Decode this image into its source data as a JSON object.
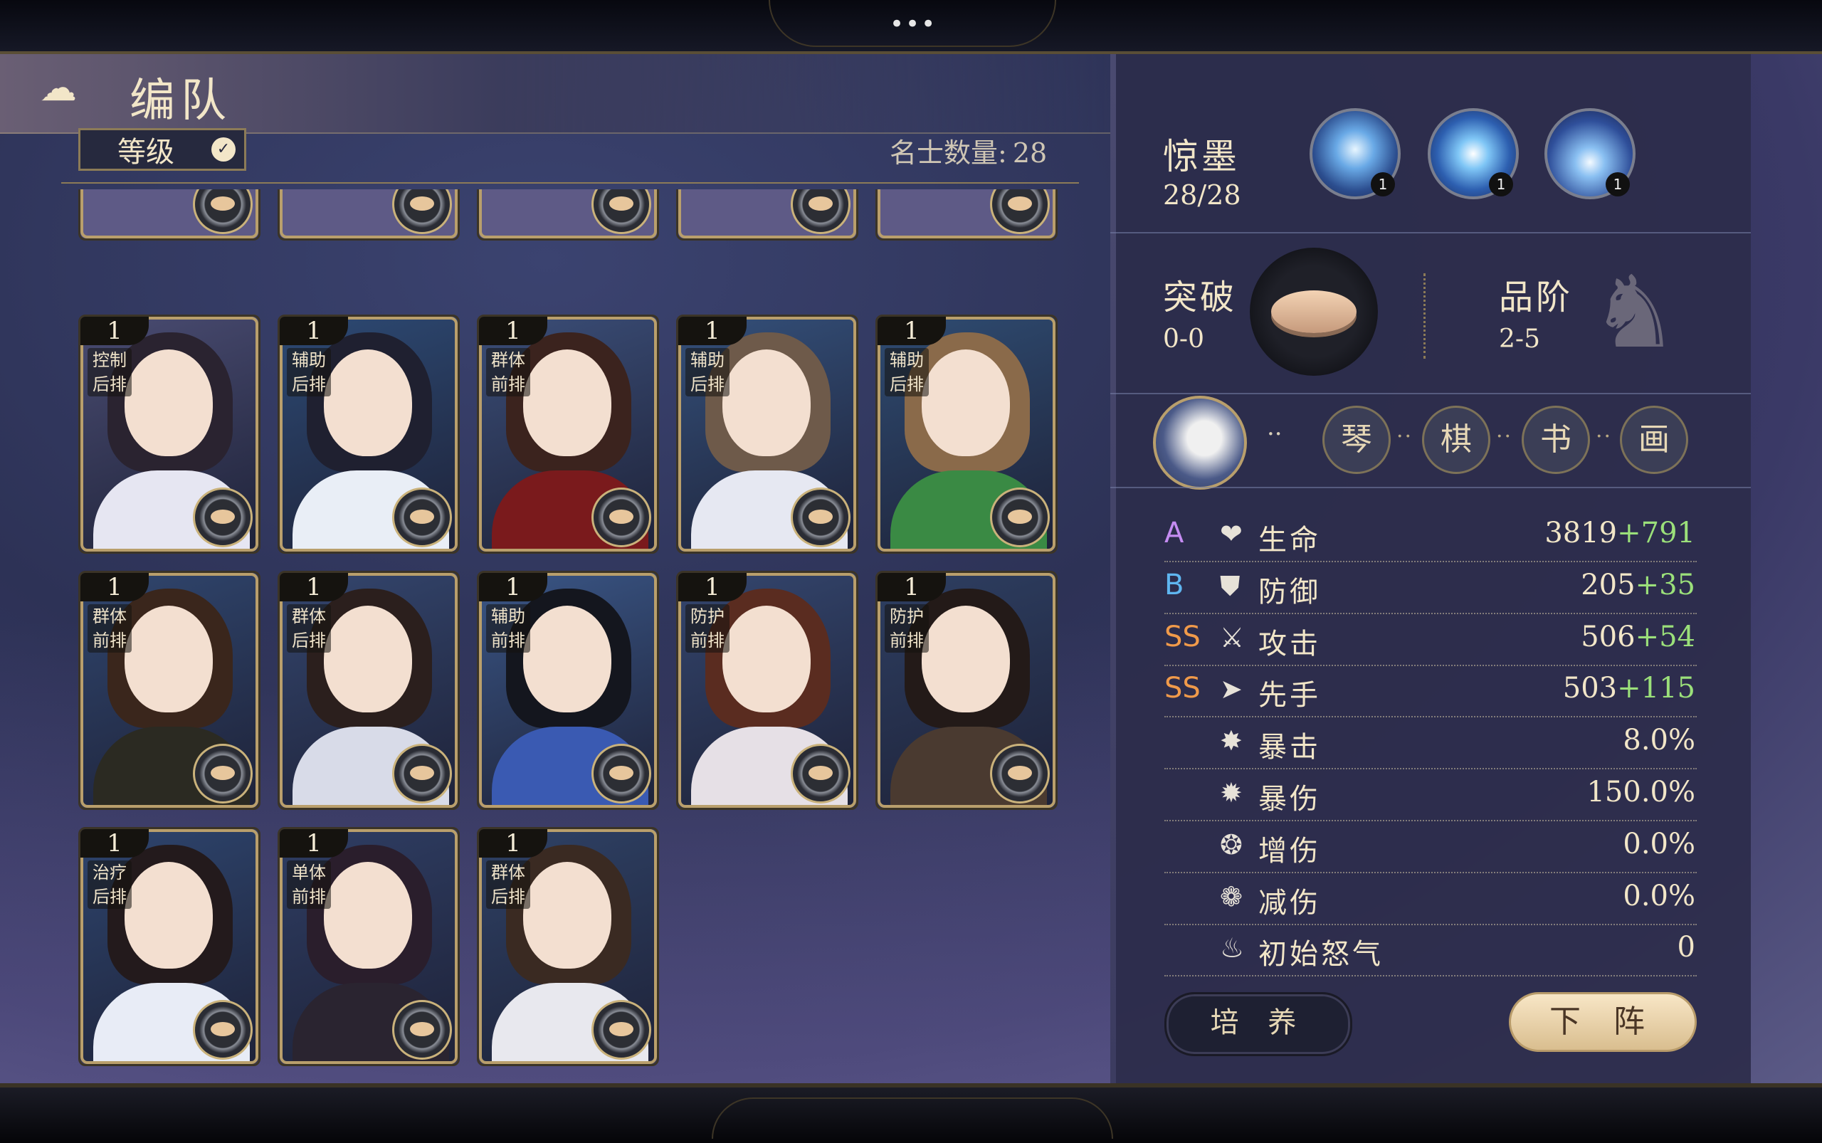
{
  "header": {
    "title": "编队",
    "back_icon": "cloud-scroll-icon"
  },
  "toolbar": {
    "sort_label": "等级",
    "count_label": "名士数量:",
    "count_value": "28"
  },
  "cards": [
    {
      "level": "1",
      "role": "控制",
      "position": "后排",
      "hair": "#2a2330",
      "robe": "#e6e6f2",
      "bg": "#4a4c72"
    },
    {
      "level": "1",
      "role": "辅助",
      "position": "后排",
      "hair": "#1f2030",
      "robe": "#e9eef6",
      "bg": "#2d4a74"
    },
    {
      "level": "1",
      "role": "群体",
      "position": "前排",
      "hair": "#3b231e",
      "robe": "#7a1a1c",
      "bg": "#3b4e78"
    },
    {
      "level": "1",
      "role": "辅助",
      "position": "后排",
      "hair": "#6e5a4a",
      "robe": "#e6e8f2",
      "bg": "#34507a"
    },
    {
      "level": "1",
      "role": "辅助",
      "position": "后排",
      "hair": "#8a6a4a",
      "robe": "#3a8a44",
      "bg": "#2f4c72"
    },
    {
      "level": "1",
      "role": "群体",
      "position": "前排",
      "hair": "#3a261c",
      "robe": "#2b2a22",
      "bg": "#30466e"
    },
    {
      "level": "1",
      "role": "群体",
      "position": "后排",
      "hair": "#2b1f1d",
      "robe": "#d8dbe8",
      "bg": "#34466e"
    },
    {
      "level": "1",
      "role": "辅助",
      "position": "前排",
      "hair": "#14161e",
      "robe": "#3a5ab2",
      "bg": "#3a5686"
    },
    {
      "level": "1",
      "role": "防护",
      "position": "前排",
      "hair": "#5a2c20",
      "robe": "#e6e0e6",
      "bg": "#34466e"
    },
    {
      "level": "1",
      "role": "防护",
      "position": "前排",
      "hair": "#231a18",
      "robe": "#4a3a30",
      "bg": "#2e3f62"
    },
    {
      "level": "1",
      "role": "治疗",
      "position": "后排",
      "hair": "#231a1c",
      "robe": "#e8ecf6",
      "bg": "#2e456e"
    },
    {
      "level": "1",
      "role": "单体",
      "position": "前排",
      "hair": "#2a1e2c",
      "robe": "#2a2430",
      "bg": "#2f3e64"
    },
    {
      "level": "1",
      "role": "群体",
      "position": "后排",
      "hair": "#3a2a22",
      "robe": "#e8e8ee",
      "bg": "#2f4266"
    }
  ],
  "detail": {
    "name": "惊墨",
    "count": "28/28",
    "skills": [
      {
        "icon": "skill-crystal-icon",
        "level": "1"
      },
      {
        "icon": "skill-swirl-icon",
        "level": "1"
      },
      {
        "icon": "skill-lightning-icon",
        "level": "1"
      }
    ],
    "breakthrough_label": "突破",
    "breakthrough_value": "0-0",
    "rank_label": "品阶",
    "rank_value": "2-5",
    "arts": [
      "琴",
      "棋",
      "书",
      "画"
    ],
    "stats": [
      {
        "grade": "A",
        "grade_color": "#c58cf2",
        "icon": "heart-icon",
        "glyph": "❤",
        "name": "生命",
        "base": "3819",
        "bonus": "+791"
      },
      {
        "grade": "B",
        "grade_color": "#5fb6f0",
        "icon": "shield-icon",
        "glyph": "⛊",
        "name": "防御",
        "base": "205",
        "bonus": "+35"
      },
      {
        "grade": "SS",
        "grade_color": "#f09a4a",
        "icon": "sword-icon",
        "glyph": "⚔",
        "name": "攻击",
        "base": "506",
        "bonus": "+54"
      },
      {
        "grade": "SS",
        "grade_color": "#f09a4a",
        "icon": "speed-icon",
        "glyph": "➤",
        "name": "先手",
        "base": "503",
        "bonus": "+115"
      },
      {
        "grade": "",
        "grade_color": "#ffffff",
        "icon": "crit-icon",
        "glyph": "✸",
        "name": "暴击",
        "base": "8.0%",
        "bonus": ""
      },
      {
        "grade": "",
        "grade_color": "#ffffff",
        "icon": "crit-damage-icon",
        "glyph": "✹",
        "name": "暴伤",
        "base": "150.0%",
        "bonus": ""
      },
      {
        "grade": "",
        "grade_color": "#ffffff",
        "icon": "damage-up-icon",
        "glyph": "❂",
        "name": "增伤",
        "base": "0.0%",
        "bonus": ""
      },
      {
        "grade": "",
        "grade_color": "#ffffff",
        "icon": "damage-down-icon",
        "glyph": "❁",
        "name": "减伤",
        "base": "0.0%",
        "bonus": ""
      },
      {
        "grade": "",
        "grade_color": "#ffffff",
        "icon": "rage-icon",
        "glyph": "♨",
        "name": "初始怒气",
        "base": "0",
        "bonus": ""
      }
    ],
    "train_label": "培 养",
    "remove_label": "下 阵"
  }
}
